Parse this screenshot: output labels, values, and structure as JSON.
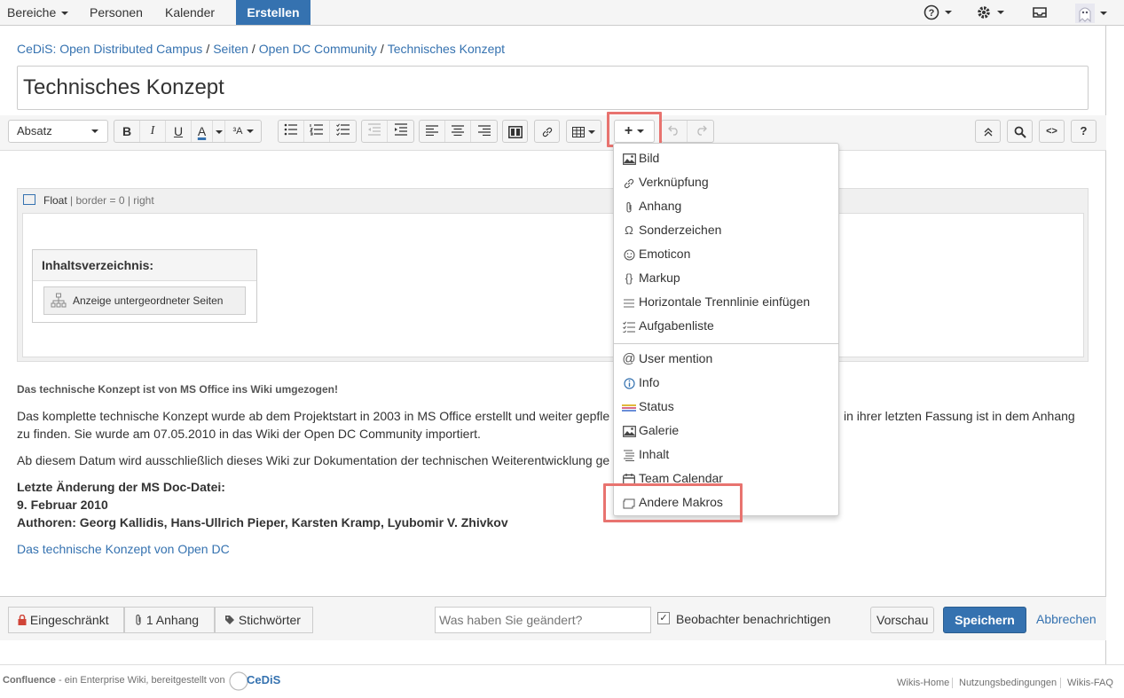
{
  "topnav": {
    "spaces": "Bereiche",
    "people": "Personen",
    "calendar": "Kalender",
    "create": "Erstellen"
  },
  "breadcrumb": [
    "CeDiS: Open Distributed Campus",
    "Seiten",
    "Open DC Community",
    "Technisches Konzept"
  ],
  "breadcrumb_separator": "/",
  "page_title": "Technisches Konzept",
  "toolbar": {
    "paragraph_style": "Absatz",
    "bold": "B",
    "italic": "I",
    "underline": "U",
    "text_color": "A",
    "more_format": "³A"
  },
  "macro": {
    "name": "Float",
    "params": "| border = 0 | right"
  },
  "toc": {
    "title": "Inhaltsverzeichnis:",
    "button": "Anzeige untergeordneter Seiten"
  },
  "content": {
    "notice": "Das technische Konzept ist von MS Office ins Wiki umgezogen!",
    "para1_line1_a": "Das komplette technische Konzept wurde ab dem Projektstart in 2003 in MS Office erstellt und weiter gepfle",
    "para1_line1_b": "in ihrer letzten Fassung ist in dem Anhang",
    "para1_line2": "zu finden. Sie wurde am 07.05.2010 in das Wiki der Open DC Community importiert.",
    "para2": "Ab diesem Datum wird ausschließlich dieses Wiki zur Dokumentation der technischen Weiterentwicklung ge",
    "last_change": "Letzte Änderung der MS Doc-Datei:",
    "date": "9. Februar 2010",
    "authors": "Authoren: Georg Kallidis, Hans-Ullrich Pieper, Karsten Kramp, Lyubomir V. Zhivkov",
    "link": "Das technische Konzept von Open DC"
  },
  "insert_menu": {
    "items": [
      {
        "label": "Bild",
        "icon": "image-icon"
      },
      {
        "label": "Verknüpfung",
        "icon": "link-icon"
      },
      {
        "label": "Anhang",
        "icon": "paperclip-icon"
      },
      {
        "label": "Sonderzeichen",
        "icon": "omega-icon"
      },
      {
        "label": "Emoticon",
        "icon": "smiley-icon"
      },
      {
        "label": "Markup",
        "icon": "braces-icon"
      },
      {
        "label": "Horizontale Trennlinie einfügen",
        "icon": "horizontal-rule-icon"
      },
      {
        "label": "Aufgabenliste",
        "icon": "tasklist-icon"
      }
    ],
    "items2": [
      {
        "label": "User mention",
        "icon": "at-icon"
      },
      {
        "label": "Info",
        "icon": "info-icon"
      },
      {
        "label": "Status",
        "icon": "status-icon"
      },
      {
        "label": "Galerie",
        "icon": "gallery-icon"
      },
      {
        "label": "Inhalt",
        "icon": "toc-icon"
      },
      {
        "label": "Team Calendar",
        "icon": "calendar-icon"
      },
      {
        "label": "Andere Makros",
        "icon": "macro-icon"
      }
    ]
  },
  "bottombar": {
    "restricted": "Eingeschränkt",
    "attachments": "1 Anhang",
    "labels": "Stichwörter",
    "comment_placeholder": "Was haben Sie geändert?",
    "notify_watchers": "Beobachter benachrichtigen",
    "notify_checked": true,
    "preview": "Vorschau",
    "save": "Speichern",
    "cancel": "Abbrechen"
  },
  "footer": {
    "brand": "Confluence",
    "text": "- ein Enterprise Wiki, bereitgestellt von",
    "logo": "CeDiS",
    "links": [
      "Wikis-Home",
      "Nutzungsbedingungen",
      "Wikis-FAQ"
    ]
  },
  "colors": {
    "accent": "#3572b0",
    "highlight": "#e8736f",
    "text_color_underline": "#3572b0"
  }
}
